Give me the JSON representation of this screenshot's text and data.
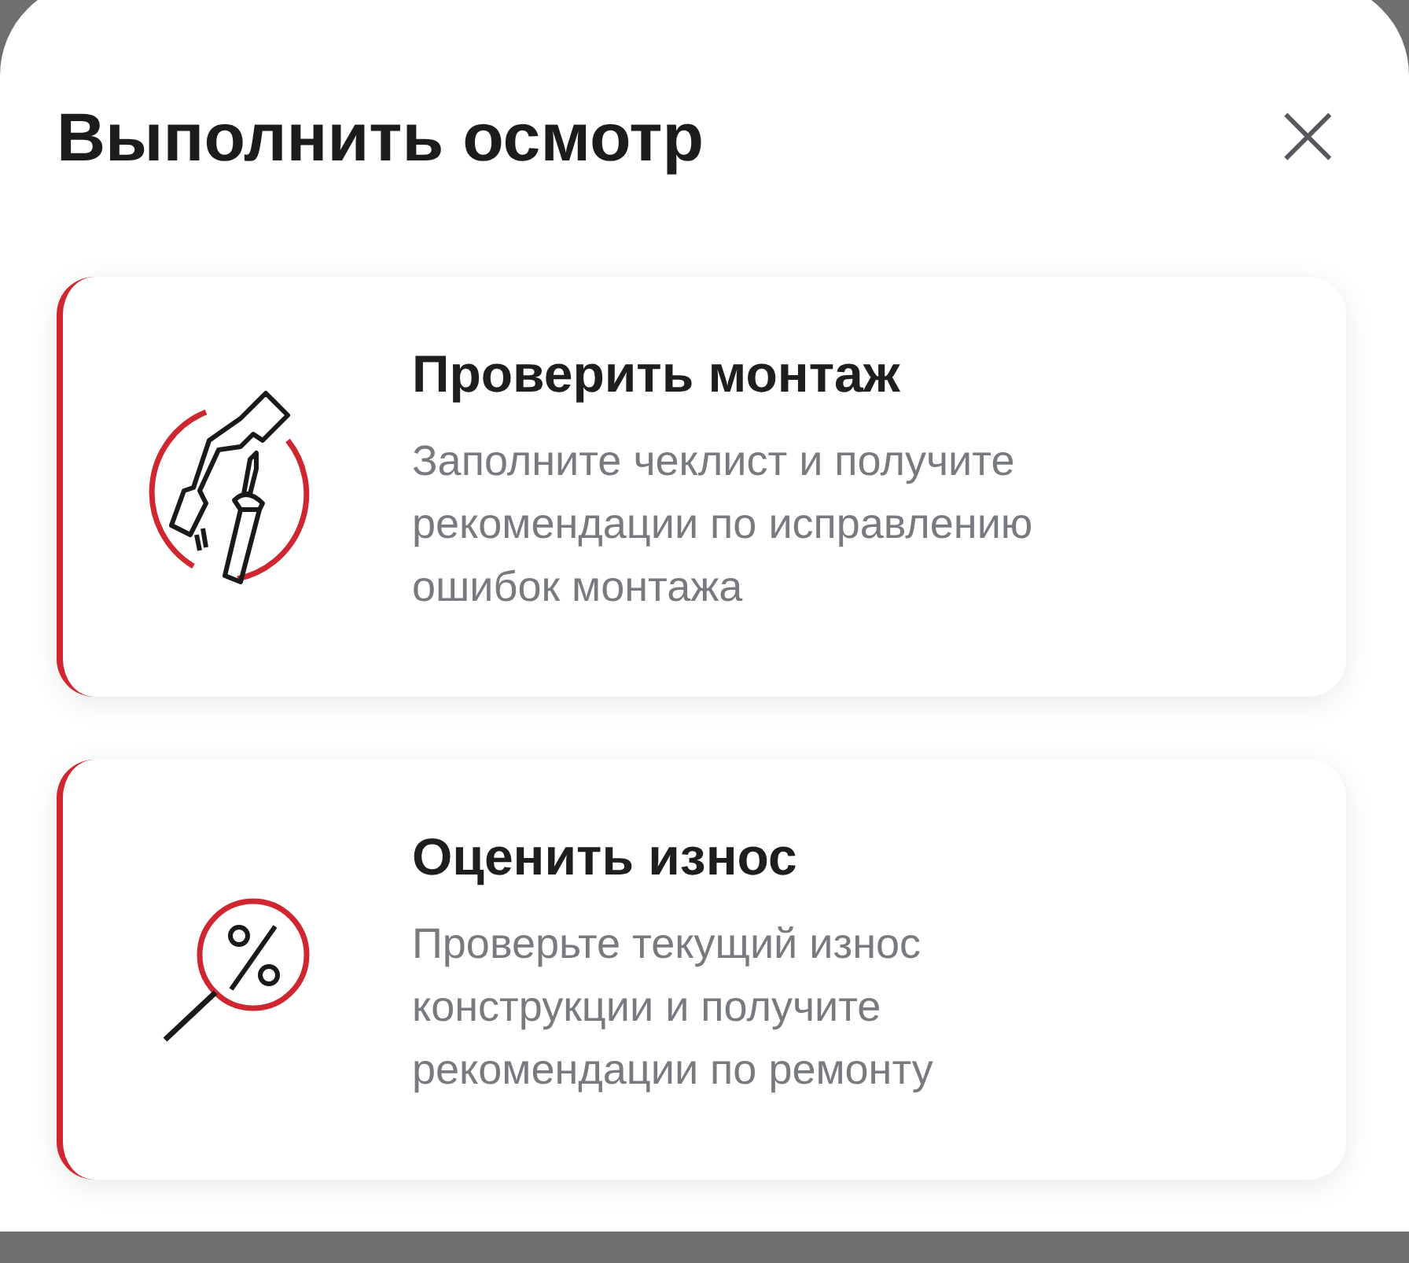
{
  "sheet": {
    "title": "Выполнить осмотр",
    "close": "×"
  },
  "cards": [
    {
      "title": "Проверить монтаж",
      "description": "Заполните чеклист и получите рекомендации по исправлению ошибок монтажа"
    },
    {
      "title": "Оценить износ",
      "description": "Проверьте текущий износ конструкции и получите рекомендации по ремонту"
    }
  ]
}
